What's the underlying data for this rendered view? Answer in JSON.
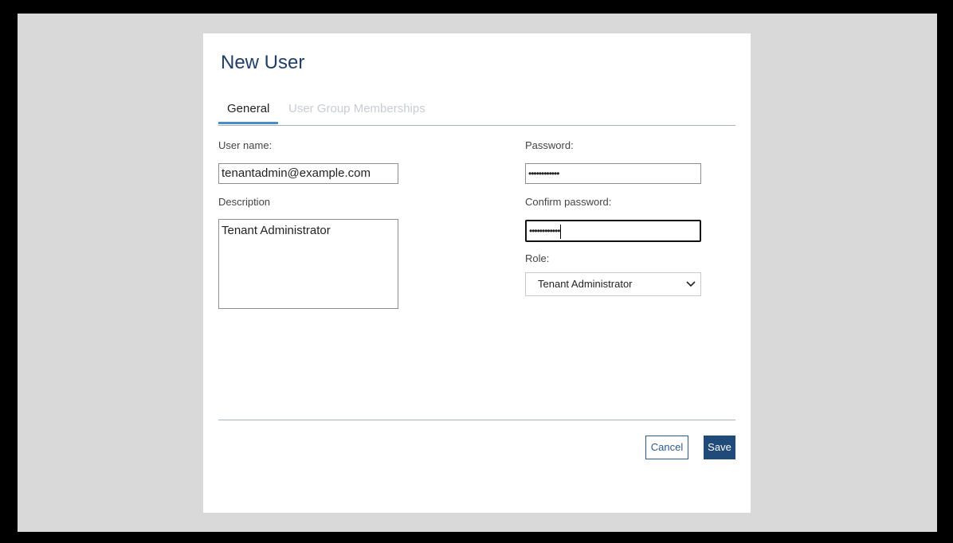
{
  "dialog": {
    "title": "New User"
  },
  "tabs": [
    {
      "label": "General",
      "active": true
    },
    {
      "label": "User Group Memberships",
      "active": false
    }
  ],
  "form": {
    "username_label": "User name:",
    "username_value": "tenantadmin@example.com",
    "description_label": "Description",
    "description_value": "Tenant Administrator",
    "password_label": "Password:",
    "password_value": "••••••••••••",
    "confirm_label": "Confirm password:",
    "confirm_value": "••••••••••••",
    "role_label": "Role:",
    "role_value": "Tenant Administrator"
  },
  "buttons": {
    "cancel_label": "Cancel",
    "save_label": "Save"
  },
  "colors": {
    "title": "#1f3f66",
    "accent": "#4a8ec9",
    "primary_button": "#1f4a7a",
    "backdrop": "#d9d9d9"
  },
  "icons": {
    "role_dropdown": "chevron-down-icon"
  }
}
